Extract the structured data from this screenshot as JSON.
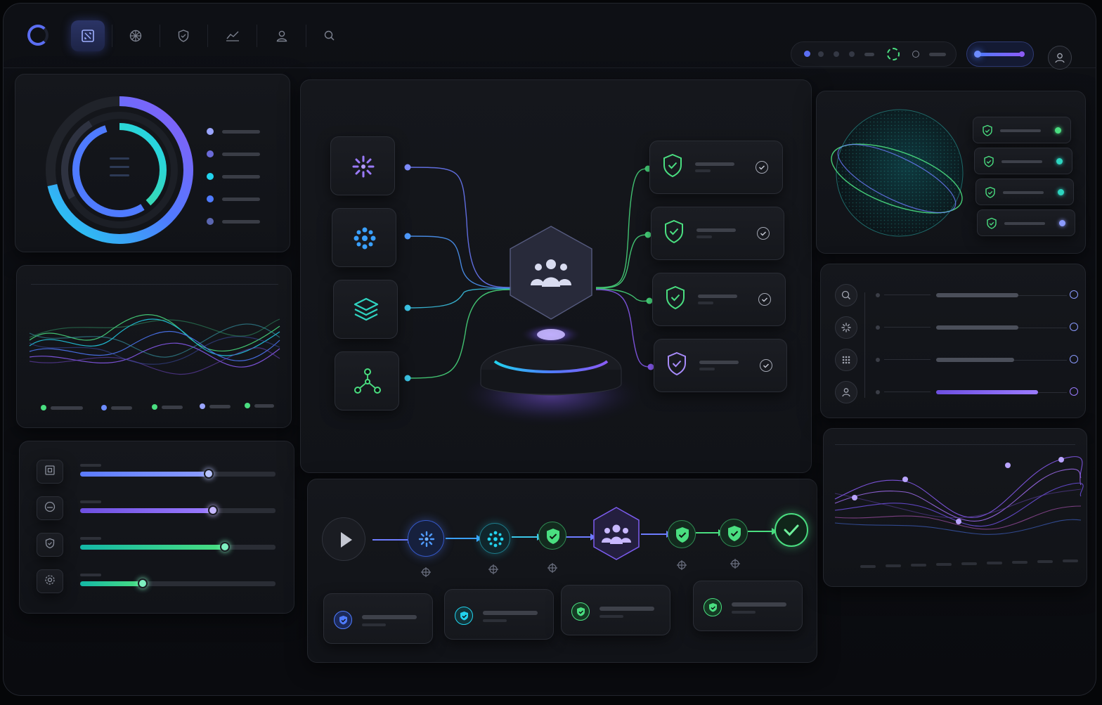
{
  "nav": {
    "items": [
      {
        "name": "collapse",
        "active": true
      },
      {
        "name": "network",
        "active": false
      },
      {
        "name": "security",
        "active": false
      },
      {
        "name": "analytics",
        "active": false
      },
      {
        "name": "users",
        "active": false
      },
      {
        "name": "search",
        "active": false
      }
    ]
  },
  "colors": {
    "accent_blue": "#4f7bff",
    "accent_violet": "#8b5cf6",
    "accent_cyan": "#22d3ee",
    "accent_green": "#4ade80",
    "panel": "#15171c"
  },
  "icons": {
    "logo": "ring-logo-icon",
    "profile": "user-avatar-icon"
  },
  "donut": {
    "legend_count": 5,
    "rings": [
      0.96,
      0.78,
      0.62
    ]
  },
  "sliders": [
    {
      "icon": "scan-icon",
      "value": 0.66
    },
    {
      "icon": "gauge-icon",
      "value": 0.68
    },
    {
      "icon": "shield-icon",
      "value": 0.74
    },
    {
      "icon": "gear-icon",
      "value": 0.32
    }
  ],
  "flow": {
    "sources": [
      "burst-icon",
      "dots-cluster-icon",
      "layers-icon",
      "network-nodes-icon"
    ],
    "hub": "team-icon",
    "targets": 4
  },
  "pipeline": {
    "steps": [
      "play-icon",
      "burst-icon",
      "dots-cluster-icon",
      "shield-check-icon",
      "team-icon",
      "shield-check-icon",
      "shield-check-icon",
      "check-icon"
    ],
    "result_cards": 4
  },
  "status_list": {
    "items": 4
  },
  "tasks": {
    "items": [
      {
        "icon": "search-icon",
        "progress": 0.55
      },
      {
        "icon": "burst-icon",
        "progress": 0.55
      },
      {
        "icon": "grid-icon",
        "progress": 0.52
      },
      {
        "icon": "user-icon",
        "progress": 0.68
      }
    ]
  }
}
